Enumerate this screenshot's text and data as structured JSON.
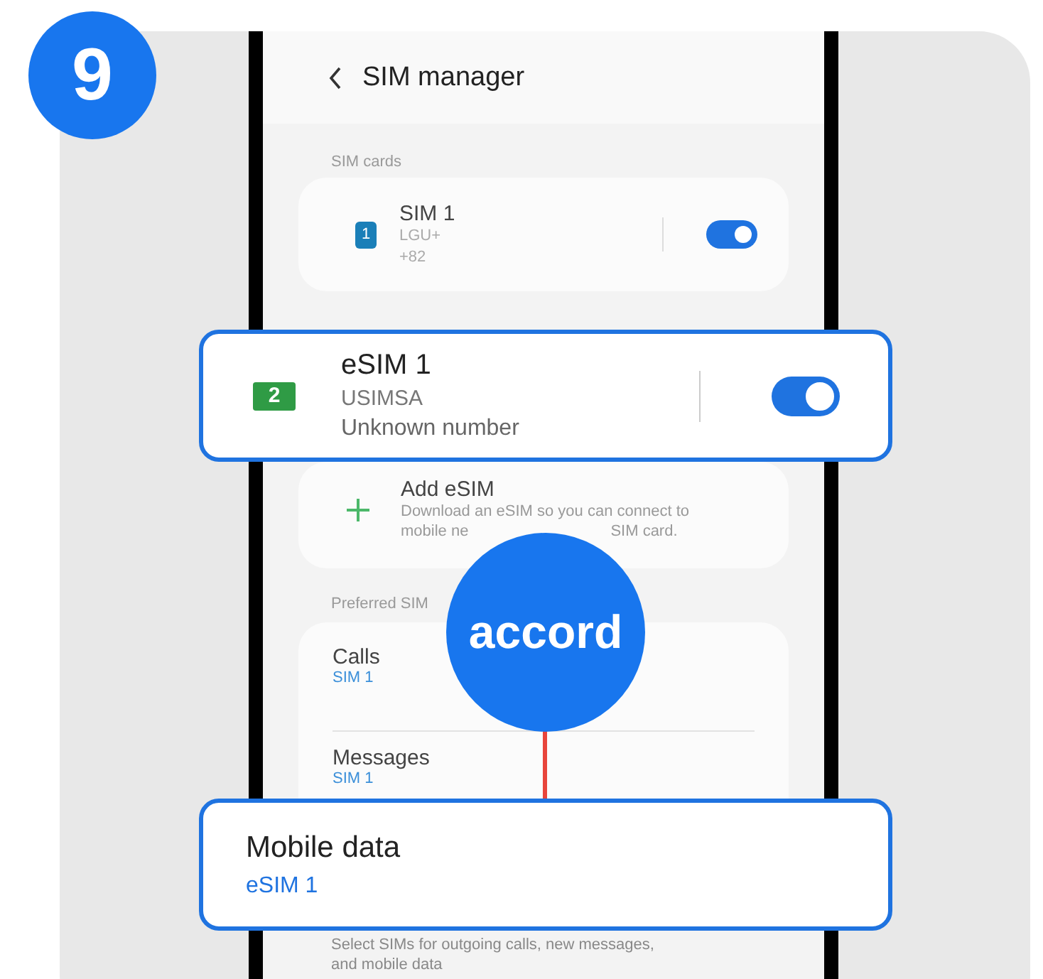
{
  "step": "9",
  "header": {
    "title": "SIM manager"
  },
  "sim_cards": {
    "label": "SIM cards",
    "items": [
      {
        "slot": "1",
        "name": "SIM 1",
        "carrier": "LGU+",
        "number": "+82",
        "on": true
      }
    ]
  },
  "add_esim": {
    "title": "Add eSIM",
    "description_line_1": "Download an eSIM so you can connect to",
    "description_line_2_start": "mobile ne",
    "description_line_2_end": "SIM card."
  },
  "preferred": {
    "label": "Preferred SIM",
    "items": [
      {
        "name": "Calls",
        "value": "SIM 1"
      },
      {
        "name": "Messages",
        "value": "SIM 1"
      }
    ]
  },
  "footer_note": [
    "Select SIMs for outgoing calls, new messages,",
    "and mobile data"
  ],
  "callouts": [
    {
      "kind": "esim",
      "slot": "2",
      "name": "eSIM 1",
      "carrier": "USIMSA",
      "number": "Unknown number",
      "on": true
    },
    {
      "kind": "setting",
      "name": "Mobile data",
      "value": "eSIM 1"
    }
  ],
  "connector_badge": "accord"
}
